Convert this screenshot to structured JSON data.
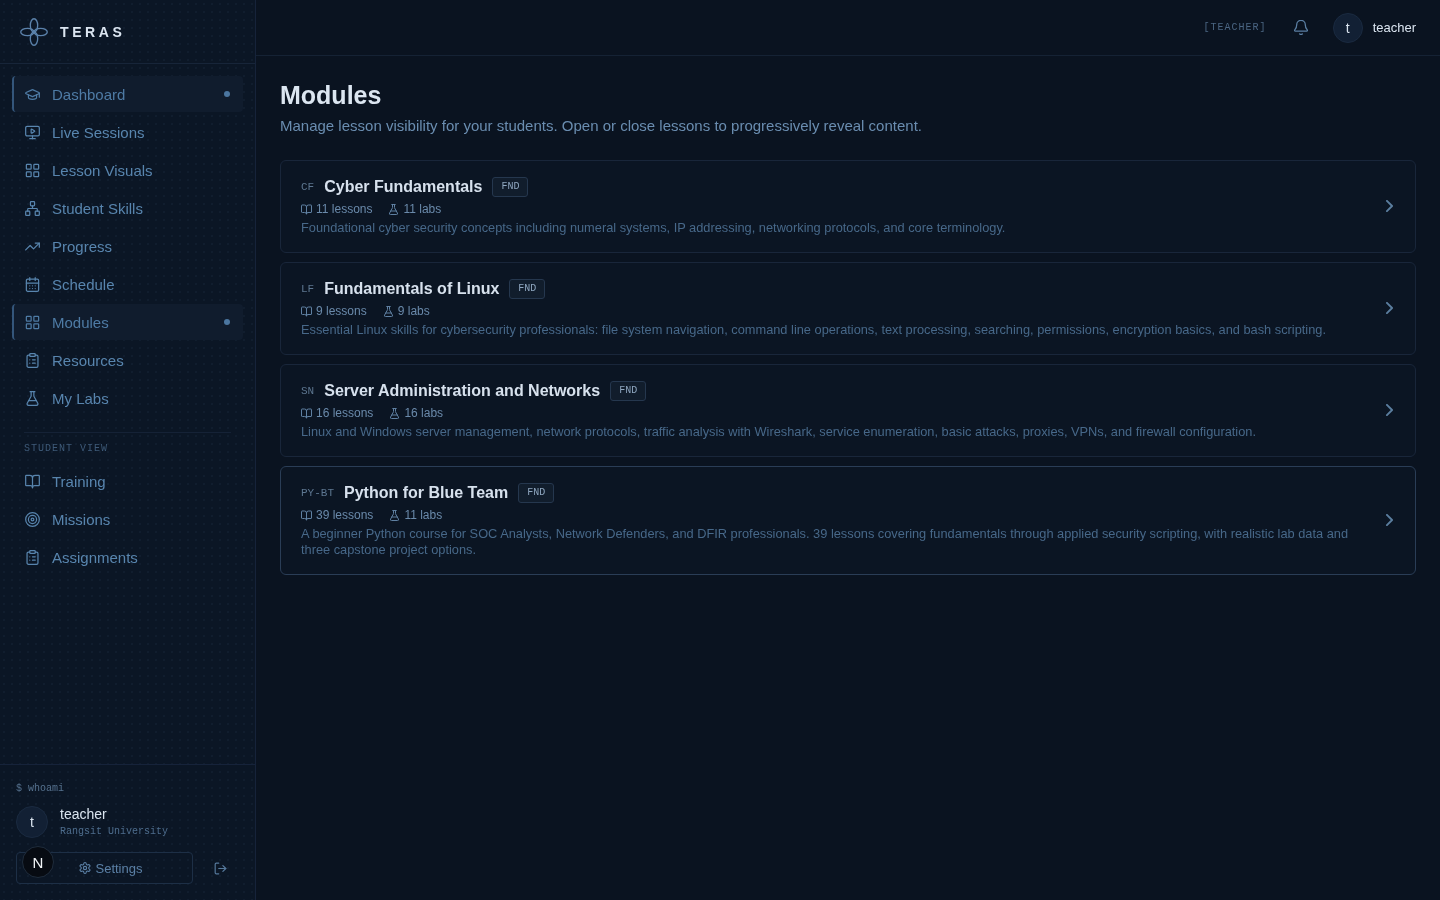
{
  "sidebar": {
    "brand": "TERAS",
    "nav": [
      {
        "label": "Dashboard",
        "selected": true
      },
      {
        "label": "Live Sessions",
        "selected": false
      },
      {
        "label": "Lesson Visuals",
        "selected": false
      },
      {
        "label": "Student Skills",
        "selected": false
      },
      {
        "label": "Progress",
        "selected": false
      },
      {
        "label": "Schedule",
        "selected": false
      },
      {
        "label": "Modules",
        "selected": true
      },
      {
        "label": "Resources",
        "selected": false
      },
      {
        "label": "My Labs",
        "selected": false
      }
    ],
    "section_label": "STUDENT VIEW",
    "student_nav": [
      {
        "label": "Training",
        "selected": false
      },
      {
        "label": "Missions",
        "selected": false
      },
      {
        "label": "Assignments",
        "selected": false
      }
    ],
    "user": {
      "prompt": "$ whoami",
      "avatar": "t",
      "name": "teacher",
      "organization": "Rangsit University"
    },
    "settings_button": "Settings",
    "floating_badge": "N"
  },
  "header": {
    "role": "[TEACHER]",
    "user": {
      "avatar": "t",
      "name": "teacher"
    }
  },
  "page": {
    "title": "Modules",
    "subtitle": "Manage lesson visibility for your students. Open or close lessons to progressively reveal content."
  },
  "modules": [
    {
      "code": "CF",
      "title": "Cyber Fundamentals",
      "tag": "FND",
      "lessons": "11 lessons",
      "labs": "11 labs",
      "description": "Foundational cyber security concepts including numeral systems, IP addressing, networking protocols, and core terminology.",
      "hovered": false
    },
    {
      "code": "LF",
      "title": "Fundamentals of Linux",
      "tag": "FND",
      "lessons": "9 lessons",
      "labs": "9 labs",
      "description": "Essential Linux skills for cybersecurity professionals: file system navigation, command line operations, text processing, searching, permissions, encryption basics, and bash scripting.",
      "hovered": false
    },
    {
      "code": "SN",
      "title": "Server Administration and Networks",
      "tag": "FND",
      "lessons": "16 lessons",
      "labs": "16 labs",
      "description": "Linux and Windows server management, network protocols, traffic analysis with Wireshark, service enumeration, basic attacks, proxies, VPNs, and firewall configuration.",
      "hovered": false
    },
    {
      "code": "PY-BT",
      "title": "Python for Blue Team",
      "tag": "FND",
      "lessons": "39 lessons",
      "labs": "11 labs",
      "description": "A beginner Python course for SOC Analysts, Network Defenders, and DFIR professionals. 39 lessons covering fundamentals through applied security scripting, with realistic lab data and three capstone project options.",
      "hovered": true
    }
  ]
}
